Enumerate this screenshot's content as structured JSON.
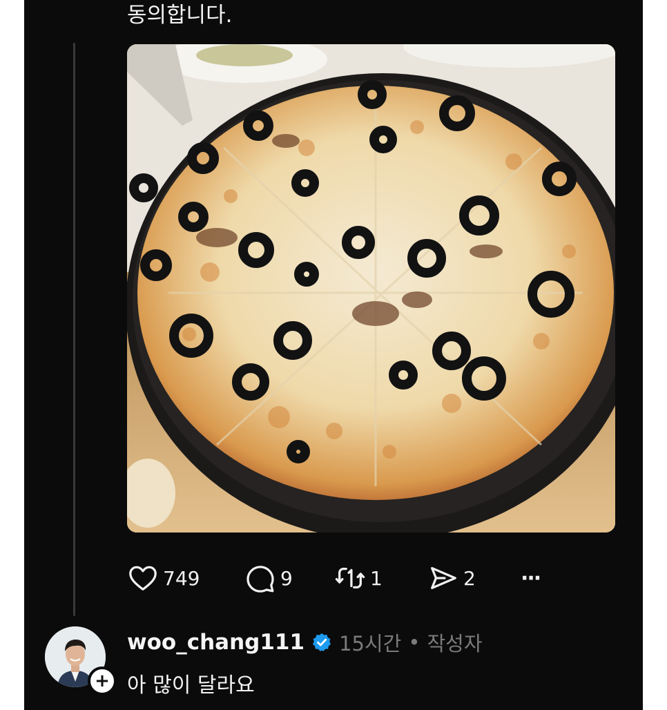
{
  "post": {
    "text_line": "동의합니다.",
    "image": "pizza-photo"
  },
  "actions": {
    "likes": "749",
    "replies": "9",
    "reposts": "1",
    "shares": "2",
    "more": "···"
  },
  "reply": {
    "username": "woo_chang111",
    "time": "15시간",
    "separator": "•",
    "author_tag": "작성자",
    "text": "아 많이 달라요",
    "follow_symbol": "+",
    "verified_color": "#1d9bf0"
  },
  "colors": {
    "background": "#0b0b0b",
    "text": "#f3f3f3",
    "muted": "#7b7b7b"
  }
}
